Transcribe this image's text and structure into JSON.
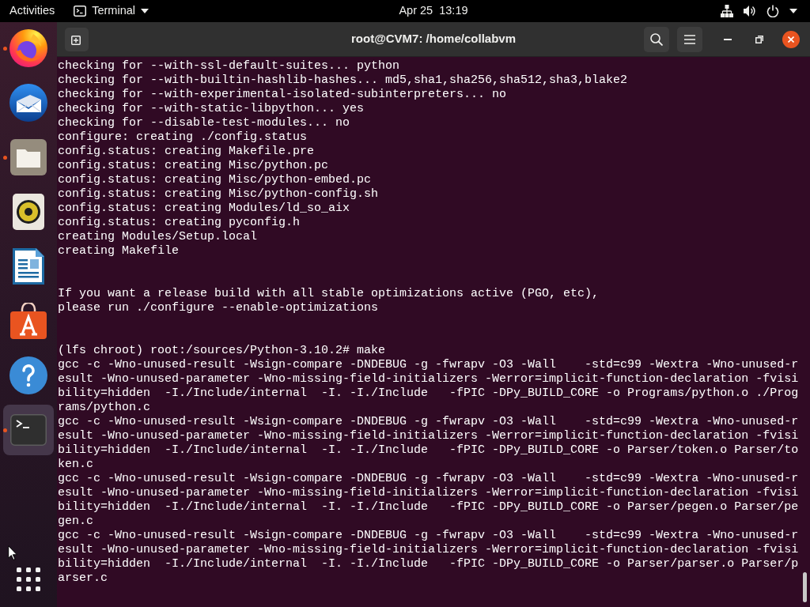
{
  "top_bar": {
    "activities": "Activities",
    "app_menu": "Terminal",
    "clock": "Apr 25  13:19"
  },
  "dock": {
    "items": [
      {
        "kind": "browser",
        "running": true,
        "selected": false
      },
      {
        "kind": "mail",
        "running": false,
        "selected": false
      },
      {
        "kind": "files",
        "running": true,
        "selected": false
      },
      {
        "kind": "music",
        "running": false,
        "selected": false
      },
      {
        "kind": "writer",
        "running": false,
        "selected": false
      },
      {
        "kind": "store",
        "running": false,
        "selected": false
      },
      {
        "kind": "help",
        "running": false,
        "selected": false
      },
      {
        "kind": "terminal",
        "running": true,
        "selected": true
      }
    ]
  },
  "window": {
    "title": "root@CVM7: /home/collabvm"
  },
  "terminal": {
    "blocks": [
      {
        "lines": [
          "checking for --with-ssl-default-suites... python",
          "checking for --with-builtin-hashlib-hashes... md5,sha1,sha256,sha512,sha3,blake2",
          "checking for --with-experimental-isolated-subinterpreters... no",
          "checking for --with-static-libpython... yes",
          "checking for --disable-test-modules... no",
          "configure: creating ./config.status",
          "config.status: creating Makefile.pre",
          "config.status: creating Misc/python.pc",
          "config.status: creating Misc/python-embed.pc",
          "config.status: creating Misc/python-config.sh",
          "config.status: creating Modules/ld_so_aix",
          "config.status: creating pyconfig.h",
          "creating Modules/Setup.local",
          "creating Makefile"
        ]
      },
      {
        "lines": [
          "If you want a release build with all stable optimizations active (PGO, etc),",
          "please run ./configure --enable-optimizations"
        ]
      },
      {
        "lines": [
          "(lfs chroot) root:/sources/Python-3.10.2# make",
          "gcc -c -Wno-unused-result -Wsign-compare -DNDEBUG -g -fwrapv -O3 -Wall    -std=c99 -Wextra -Wno-unused-r",
          "esult -Wno-unused-parameter -Wno-missing-field-initializers -Werror=implicit-function-declaration -fvisi",
          "bility=hidden  -I./Include/internal  -I. -I./Include   -fPIC -DPy_BUILD_CORE -o Programs/python.o ./Prog",
          "rams/python.c",
          "gcc -c -Wno-unused-result -Wsign-compare -DNDEBUG -g -fwrapv -O3 -Wall    -std=c99 -Wextra -Wno-unused-r",
          "esult -Wno-unused-parameter -Wno-missing-field-initializers -Werror=implicit-function-declaration -fvisi",
          "bility=hidden  -I./Include/internal  -I. -I./Include   -fPIC -DPy_BUILD_CORE -o Parser/token.o Parser/to",
          "ken.c",
          "gcc -c -Wno-unused-result -Wsign-compare -DNDEBUG -g -fwrapv -O3 -Wall    -std=c99 -Wextra -Wno-unused-r",
          "esult -Wno-unused-parameter -Wno-missing-field-initializers -Werror=implicit-function-declaration -fvisi",
          "bility=hidden  -I./Include/internal  -I. -I./Include   -fPIC -DPy_BUILD_CORE -o Parser/pegen.o Parser/pe",
          "gen.c",
          "gcc -c -Wno-unused-result -Wsign-compare -DNDEBUG -g -fwrapv -O3 -Wall    -std=c99 -Wextra -Wno-unused-r",
          "esult -Wno-unused-parameter -Wno-missing-field-initializers -Werror=implicit-function-declaration -fvisi",
          "bility=hidden  -I./Include/internal  -I. -I./Include   -fPIC -DPy_BUILD_CORE -o Parser/parser.o Parser/p",
          "arser.c"
        ]
      }
    ]
  }
}
